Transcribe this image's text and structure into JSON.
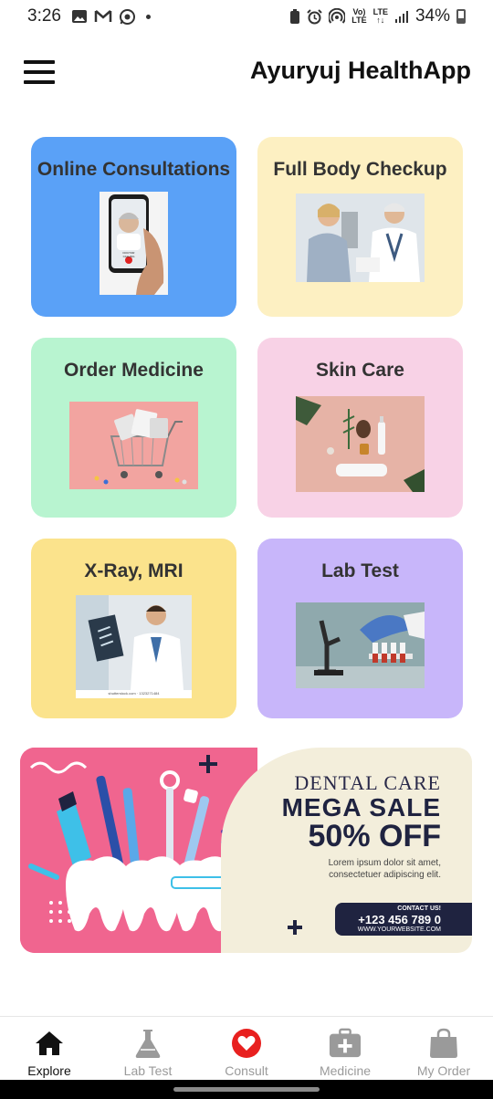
{
  "status_bar": {
    "time": "3:26",
    "battery": "34%",
    "volte_top": "Vo)",
    "volte_bottom": "LTE",
    "lte_top": "LTE",
    "lte_bottom": "↑↓"
  },
  "app_bar": {
    "title": "Ayuryuj HealthApp"
  },
  "cards": [
    {
      "title": "Online Consultations",
      "bg": "#5aa1f7"
    },
    {
      "title": "Full Body Checkup",
      "bg": "#fdf0c2"
    },
    {
      "title": "Order Medicine",
      "bg": "#b8f4d0"
    },
    {
      "title": "Skin Care",
      "bg": "#f8d2e6"
    },
    {
      "title": "X-Ray, MRI",
      "bg": "#fbe38c"
    },
    {
      "title": "Lab Test",
      "bg": "#c8b6fa"
    }
  ],
  "card_images": {
    "consult_caption": "DOCTOR CALLING",
    "xray_caption": "shutterstock.com · 1323271484"
  },
  "banner": {
    "line1": "DENTAL CARE",
    "line2": "MEGA SALE",
    "line3": "50% OFF",
    "body": "Lorem ipsum dolor sit amet, consectetuer adipiscing elit.",
    "contact_label": "CONTACT US!",
    "phone": "+123 456 789 0",
    "website": "WWW.YOURWEBSITE.COM"
  },
  "bottom_nav": [
    {
      "label": "Explore",
      "icon": "home-icon",
      "active": true
    },
    {
      "label": "Lab Test",
      "icon": "flask-icon",
      "active": false
    },
    {
      "label": "Consult",
      "icon": "heart-icon",
      "active": false
    },
    {
      "label": "Medicine",
      "icon": "medkit-icon",
      "active": false
    },
    {
      "label": "My Order",
      "icon": "bag-icon",
      "active": false
    }
  ],
  "colors": {
    "active_nav": "#111111",
    "inactive_nav": "#9a9a9a",
    "consult_red": "#e8201f",
    "banner_pink": "#f0658f",
    "banner_navy": "#1f2340"
  }
}
